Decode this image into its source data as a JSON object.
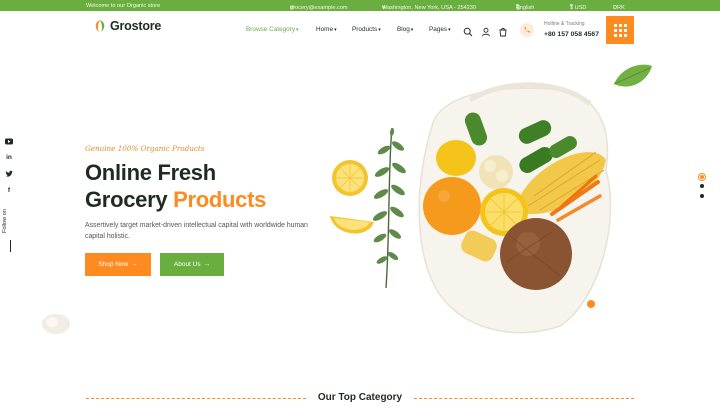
{
  "colors": {
    "brand_green": "#6aae3f",
    "accent_orange": "#ff8a1f",
    "text_dark": "#1f2b22"
  },
  "topbar": {
    "welcome": "Welcome to our Organic store",
    "email": "grocery@example.com",
    "location": "Washington, New York, USA - 254230",
    "language": "English",
    "currency": "$ USD",
    "mode": "DRK"
  },
  "header": {
    "logo": "Grostore",
    "nav": [
      "Browse Category",
      "Home",
      "Products",
      "Blog",
      "Pages"
    ],
    "phone_label": "Hotline & Tracking",
    "phone_number": "+80 157 058 4567"
  },
  "social": {
    "icons": [
      "youtube-icon",
      "linkedin-icon",
      "twitter-icon",
      "facebook-icon"
    ],
    "follow_label": "Follow on"
  },
  "hero": {
    "tagline": "Genuine 100% Organic Products",
    "title_line1": "Online Fresh",
    "title_line2_plain": "Grocery",
    "title_line2_accent": "Products",
    "description": "Assertively target market-driven intellectual capital with worldwide human capital holistic.",
    "shop_button": "Shop Now",
    "about_button": "About Us"
  },
  "slider": {
    "dot_count": 3,
    "active_dot": 1
  },
  "category_heading": "Our Top Category"
}
